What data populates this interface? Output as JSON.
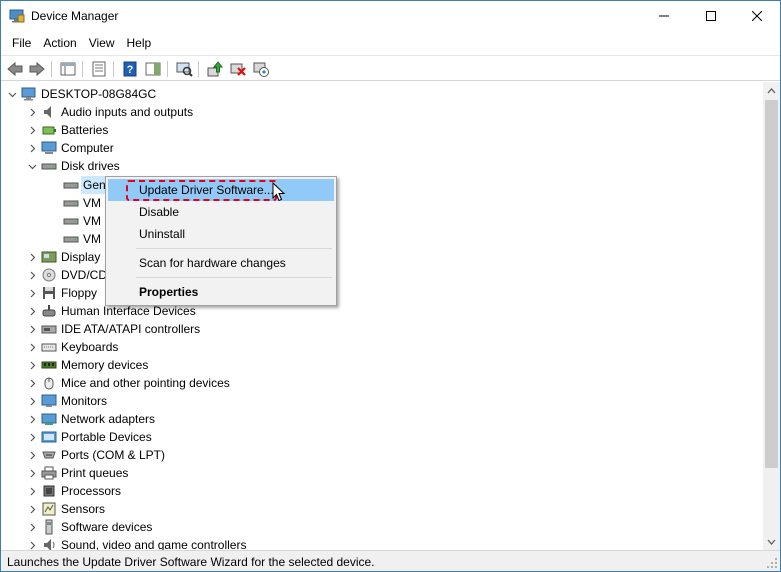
{
  "window": {
    "title": "Device Manager"
  },
  "menu": [
    "File",
    "Action",
    "View",
    "Help"
  ],
  "tree": {
    "root": "DESKTOP-08G84GC",
    "items": [
      {
        "label": "Audio inputs and outputs",
        "icon": "speaker-icon",
        "expanded": false
      },
      {
        "label": "Batteries",
        "icon": "battery-icon",
        "expanded": false
      },
      {
        "label": "Computer",
        "icon": "computer-icon",
        "expanded": false
      },
      {
        "label": "Disk drives",
        "icon": "disk-drive-icon",
        "expanded": true,
        "children": [
          "Gen",
          "VM",
          "VM",
          "VM"
        ]
      },
      {
        "label": "Display",
        "icon": "display-adapter-icon",
        "expanded": false
      },
      {
        "label": "DVD/CD",
        "icon": "dvd-icon",
        "expanded": false
      },
      {
        "label": "Floppy",
        "icon": "floppy-icon",
        "expanded": false
      },
      {
        "label": "Human Interface Devices",
        "icon": "hid-icon",
        "expanded": false
      },
      {
        "label": "IDE ATA/ATAPI controllers",
        "icon": "ide-controller-icon",
        "expanded": false
      },
      {
        "label": "Keyboards",
        "icon": "keyboard-icon",
        "expanded": false
      },
      {
        "label": "Memory devices",
        "icon": "memory-icon",
        "expanded": false
      },
      {
        "label": "Mice and other pointing devices",
        "icon": "mouse-icon",
        "expanded": false
      },
      {
        "label": "Monitors",
        "icon": "monitor-icon",
        "expanded": false
      },
      {
        "label": "Network adapters",
        "icon": "network-icon",
        "expanded": false
      },
      {
        "label": "Portable Devices",
        "icon": "portable-device-icon",
        "expanded": false
      },
      {
        "label": "Ports (COM & LPT)",
        "icon": "port-icon",
        "expanded": false
      },
      {
        "label": "Print queues",
        "icon": "printer-icon",
        "expanded": false
      },
      {
        "label": "Processors",
        "icon": "processor-icon",
        "expanded": false
      },
      {
        "label": "Sensors",
        "icon": "sensor-icon",
        "expanded": false
      },
      {
        "label": "Software devices",
        "icon": "software-device-icon",
        "expanded": false
      },
      {
        "label": "Sound, video and game controllers",
        "icon": "sound-icon",
        "expanded": false
      }
    ]
  },
  "context_menu": {
    "update": "Update Driver Software...",
    "disable": "Disable",
    "uninstall": "Uninstall",
    "scan": "Scan for hardware changes",
    "properties": "Properties"
  },
  "status": "Launches the Update Driver Software Wizard for the selected device.",
  "colors": {
    "highlight": "#91c9f7",
    "annotation": "#e2001a",
    "selection": "#cce8ff"
  }
}
